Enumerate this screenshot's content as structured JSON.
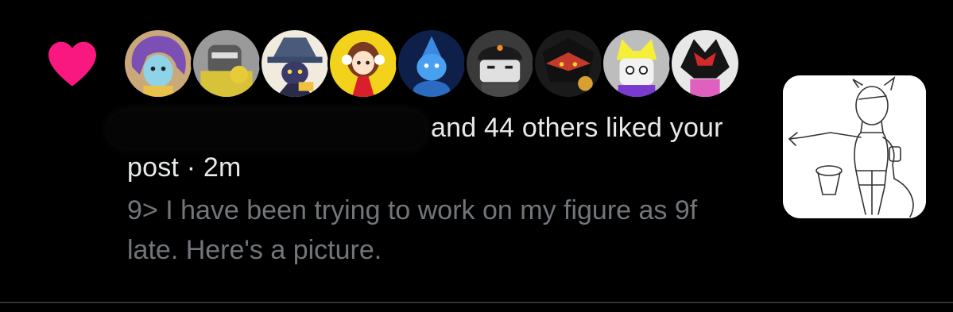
{
  "notification": {
    "liked_by_suffix": "and 44 others liked your post",
    "separator": "·",
    "time": "2m",
    "post_text": "9> I have been trying to work on my figure as 9f late. Here's a picture.",
    "heart_color": "#f91880"
  },
  "avatars": [
    {
      "name": "avatar-purple-hair",
      "bg": "#c9a97a"
    },
    {
      "name": "avatar-cat-meme",
      "bg": "#9a9a9a"
    },
    {
      "name": "avatar-witch-hat",
      "bg": "#4a5a7a"
    },
    {
      "name": "avatar-headphones-girl",
      "bg": "#f2d21a"
    },
    {
      "name": "avatar-blue-creature",
      "bg": "#1e3a8a"
    },
    {
      "name": "avatar-robot-head",
      "bg": "#3a3a3a"
    },
    {
      "name": "avatar-dark-hedgehog",
      "bg": "#c33a2a"
    },
    {
      "name": "avatar-yellow-hat",
      "bg": "#f5ef3a"
    },
    {
      "name": "avatar-black-red-character",
      "bg": "#e8e8e8"
    }
  ]
}
